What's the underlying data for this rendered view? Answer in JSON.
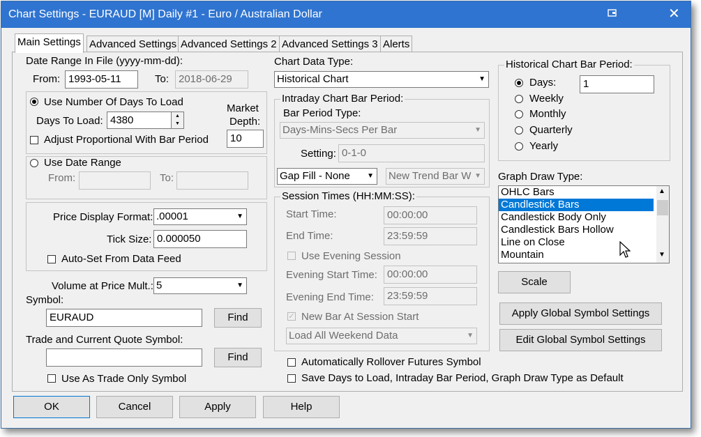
{
  "window": {
    "title": "Chart Settings - EURAUD [M]  Daily  #1 - Euro / Australian Dollar",
    "close": "✕",
    "pin_icon": "pin-icon"
  },
  "tabs": [
    "Main Settings",
    "Advanced Settings",
    "Advanced Settings 2",
    "Advanced Settings 3",
    "Alerts"
  ],
  "left": {
    "date_range_label": "Date Range In File (yyyy-mm-dd):",
    "from_label": "From:",
    "from_value": "1993-05-11",
    "to_label": "To:",
    "to_value": "2018-06-29",
    "use_days_label": "Use Number Of Days To Load",
    "days_to_load_label": "Days To Load:",
    "days_to_load_value": "4380",
    "market_depth_label_1": "Market",
    "market_depth_label_2": "Depth:",
    "market_depth_value": "10",
    "adjust_label": "Adjust Proportional With Bar Period",
    "use_date_range_label": "Use Date Range",
    "dr_from_label": "From:",
    "dr_to_label": "To:",
    "price_format_label": "Price Display Format:",
    "price_format_value": ".00001",
    "tick_size_label": "Tick Size:",
    "tick_size_value": "0.000050",
    "auto_set_label": "Auto-Set From Data Feed",
    "volume_label": "Volume at Price Mult.:",
    "volume_value": "5",
    "symbol_label": "Symbol:",
    "symbol_value": "EURAUD",
    "find_label": "Find",
    "trade_symbol_label": "Trade and Current Quote Symbol:",
    "trade_symbol_value": "",
    "find2_label": "Find",
    "trade_only_label": "Use As Trade Only Symbol"
  },
  "middle": {
    "chart_data_type_label": "Chart Data Type:",
    "chart_data_type_value": "Historical Chart",
    "intraday_group": "Intraday Chart Bar Period:",
    "bar_period_type_label": "Bar Period Type:",
    "bar_period_type_value": "Days-Mins-Secs Per Bar",
    "setting_label": "Setting:",
    "setting_value": "0-1-0",
    "gap_fill_value": "Gap Fill - None",
    "new_trend_value": "New Trend Bar W",
    "session_group": "Session Times (HH:MM:SS):",
    "start_time_label": "Start Time:",
    "start_time_value": "00:00:00",
    "end_time_label": "End Time:",
    "end_time_value": "23:59:59",
    "use_evening_label": "Use Evening Session",
    "evening_start_label": "Evening Start Time:",
    "evening_start_value": "00:00:00",
    "evening_end_label": "Evening End Time:",
    "evening_end_value": "23:59:59",
    "new_bar_label": "New Bar At Session Start",
    "weekend_value": "Load All Weekend Data",
    "rollover_label": "Automatically Rollover Futures Symbol",
    "save_days_label": "Save Days to Load, Intraday Bar Period, Graph Draw Type as Default"
  },
  "right": {
    "hist_group": "Historical Chart Bar Period:",
    "days_label": "Days:",
    "days_value": "1",
    "weekly_label": "Weekly",
    "monthly_label": "Monthly",
    "quarterly_label": "Quarterly",
    "yearly_label": "Yearly",
    "graph_draw_label": "Graph Draw Type:",
    "graph_items": [
      "OHLC Bars",
      "Candlestick Bars",
      "Candlestick Body Only",
      "Candlestick Bars Hollow",
      "Line on Close",
      "Mountain"
    ],
    "scale_label": "Scale",
    "apply_global_label": "Apply Global Symbol Settings",
    "edit_global_label": "Edit Global Symbol Settings"
  },
  "footer": {
    "ok": "OK",
    "cancel": "Cancel",
    "apply": "Apply",
    "help": "Help"
  },
  "colors": {
    "titlebar": "#2f74d0",
    "selection": "#0078d7"
  }
}
